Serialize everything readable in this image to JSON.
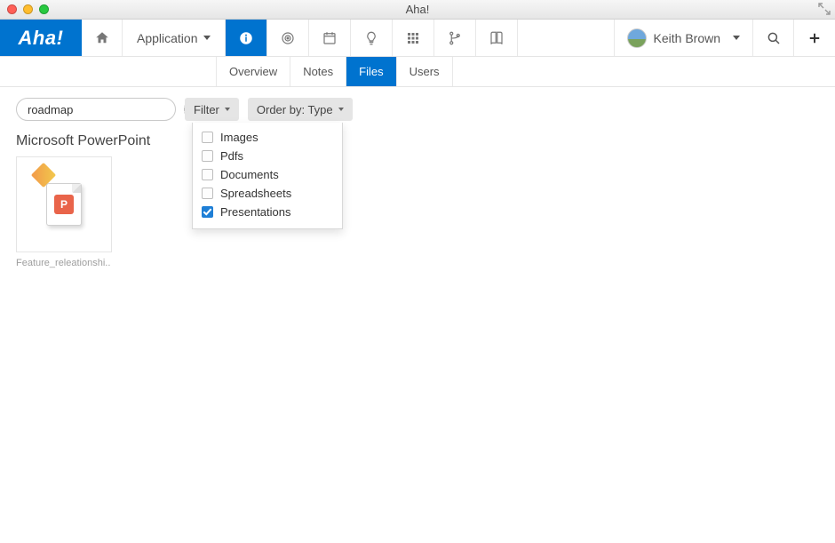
{
  "window": {
    "title": "Aha!"
  },
  "brand": {
    "logo_text": "Aha!"
  },
  "topnav": {
    "application_label": "Application",
    "user_name": "Keith Brown"
  },
  "tabs": {
    "overview": "Overview",
    "notes": "Notes",
    "files": "Files",
    "users": "Users",
    "active": "files"
  },
  "search": {
    "value": "roadmap",
    "placeholder": ""
  },
  "toolbar": {
    "filter_label": "Filter",
    "orderby_label": "Order by: Type"
  },
  "filter_options": [
    {
      "label": "Images",
      "checked": false
    },
    {
      "label": "Pdfs",
      "checked": false
    },
    {
      "label": "Documents",
      "checked": false
    },
    {
      "label": "Spreadsheets",
      "checked": false
    },
    {
      "label": "Presentations",
      "checked": true
    }
  ],
  "group": {
    "title": "Microsoft PowerPoint"
  },
  "files": [
    {
      "name": "Feature_releationshi..",
      "badge": "P"
    }
  ]
}
